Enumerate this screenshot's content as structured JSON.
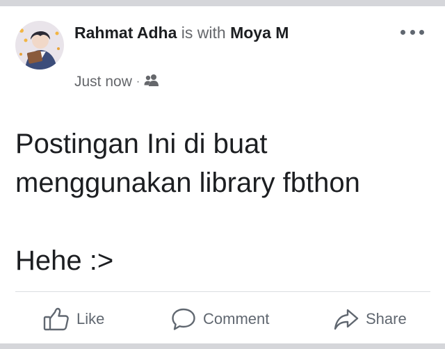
{
  "post": {
    "author": "Rahmat Adha",
    "with_word": "is with",
    "tagged": "Moya M",
    "timestamp": "Just now",
    "separator": "·",
    "audience_icon": "friends-icon",
    "text": "Postingan Ini di buat\nmenggunakan library fbthon\n\nHehe :>"
  },
  "actions": {
    "like_label": "Like",
    "comment_label": "Comment",
    "share_label": "Share"
  },
  "icons": {
    "more": "more-options-icon",
    "like": "thumbs-up-icon",
    "comment": "comment-bubble-icon",
    "share": "share-arrow-icon"
  },
  "colors": {
    "text": "#1c1e21",
    "muted": "#65676b",
    "action": "#606770",
    "divider": "#dadde1",
    "page_background": "#d5d6da"
  }
}
